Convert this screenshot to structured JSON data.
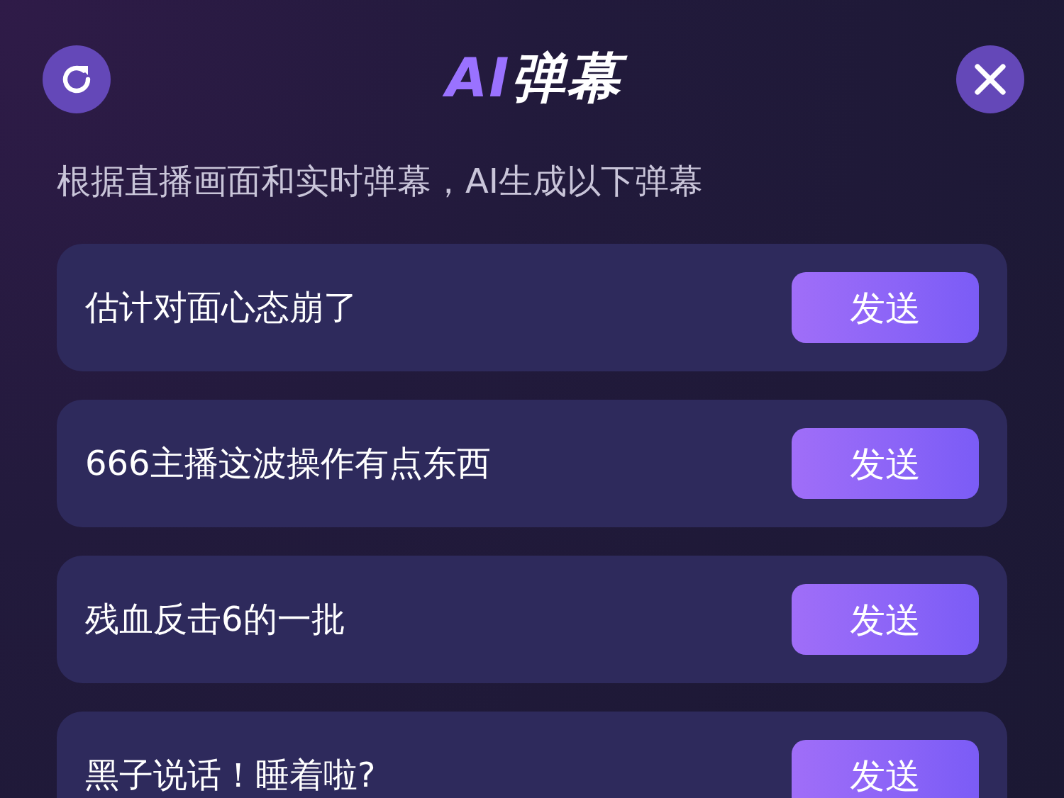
{
  "header": {
    "title_accent": "AI",
    "title": "弹幕"
  },
  "subtitle": "根据直播画面和实时弹幕，AI生成以下弹幕",
  "suggestions": [
    {
      "text": "估计对面心态崩了",
      "button": "发送"
    },
    {
      "text": "666主播这波操作有点东西",
      "button": "发送"
    },
    {
      "text": "残血反击6的一批",
      "button": "发送"
    },
    {
      "text": "黑子说话！睡着啦?",
      "button": "发送"
    }
  ]
}
